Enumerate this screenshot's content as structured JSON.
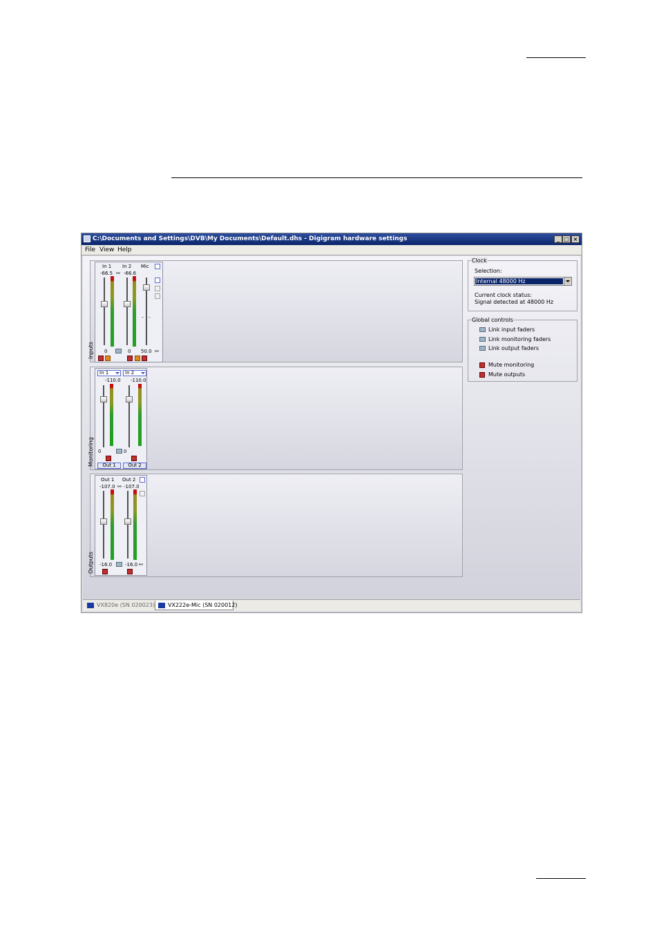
{
  "window": {
    "title": "C:\\Documents and Settings\\DVB\\My Documents\\Default.dhs - Digigram hardware settings",
    "controls": {
      "minimize": "_",
      "maximize": "□",
      "close": "×"
    }
  },
  "menu": [
    "File",
    "View",
    "Help"
  ],
  "inputs": {
    "label": "Inputs",
    "channels": [
      {
        "name": "In 1",
        "top_value": "-66.5",
        "bottom_value": "0"
      },
      {
        "name": "In 2",
        "top_value": "-66.6",
        "bottom_value": "0"
      },
      {
        "name": "Mic",
        "bottom_value": "50.0",
        "dash1": "-",
        "dash2": "-"
      }
    ]
  },
  "monitoring": {
    "label": "Monitoring",
    "channels": [
      {
        "source": "In 1",
        "top_value": "-110.0",
        "bottom_value": "0",
        "output": "Out 1"
      },
      {
        "source": "In 2",
        "top_value": "-110.0",
        "bottom_value": "0",
        "output": "Out 2"
      }
    ]
  },
  "outputs": {
    "label": "Outputs",
    "channels": [
      {
        "name": "Out 1",
        "top_value": "-107.0",
        "bottom_value": "-16.0"
      },
      {
        "name": "Out 2",
        "top_value": "-107.0",
        "bottom_value": "-16.0"
      }
    ]
  },
  "clock": {
    "title": "Clock",
    "selection_label": "Selection:",
    "selection_value": "Internal 48000 Hz",
    "status_label": "Current clock status:",
    "status_value": "Signal detected at 48000 Hz"
  },
  "global_controls": {
    "title": "Global controls",
    "links": [
      "Link input faders",
      "Link monitoring faders",
      "Link output faders"
    ],
    "mutes": [
      "Mute monitoring",
      "Mute outputs"
    ]
  },
  "tabs": [
    {
      "label": "VX820e (SN 020023)",
      "active": false
    },
    {
      "label": "VX222e-Mic (SN 020012)",
      "active": true
    }
  ],
  "colors": {
    "titlebar": "#0a246a",
    "mute": "#c03030",
    "meter_green": "#20a020",
    "selection": "#0a246a"
  }
}
